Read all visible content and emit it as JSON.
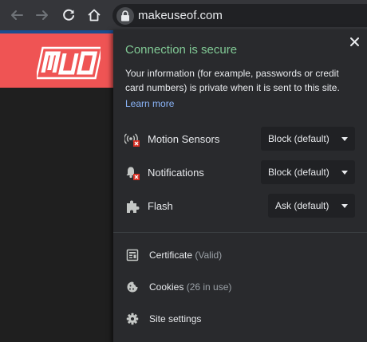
{
  "browser": {
    "url": "makeuseof.com"
  },
  "site": {
    "logo_text": "MUO",
    "header_color": "#ef5454"
  },
  "popup": {
    "title": "Connection is secure",
    "title_color": "#81c995",
    "description": "Your information (for example, passwords or credit card numbers) is private when it is sent to this site.",
    "learn_more": "Learn more",
    "permissions": [
      {
        "icon": "motion-sensors-blocked-icon",
        "label": "Motion Sensors",
        "value": "Block (default)"
      },
      {
        "icon": "notifications-blocked-icon",
        "label": "Notifications",
        "value": "Block (default)"
      },
      {
        "icon": "puzzle-piece-icon",
        "label": "Flash",
        "value": "Ask (default)"
      }
    ],
    "links": [
      {
        "icon": "certificate-icon",
        "label": "Certificate",
        "detail": "(Valid)"
      },
      {
        "icon": "cookie-icon",
        "label": "Cookies",
        "detail": "(26 in use)"
      },
      {
        "icon": "gear-icon",
        "label": "Site settings",
        "detail": ""
      }
    ]
  }
}
